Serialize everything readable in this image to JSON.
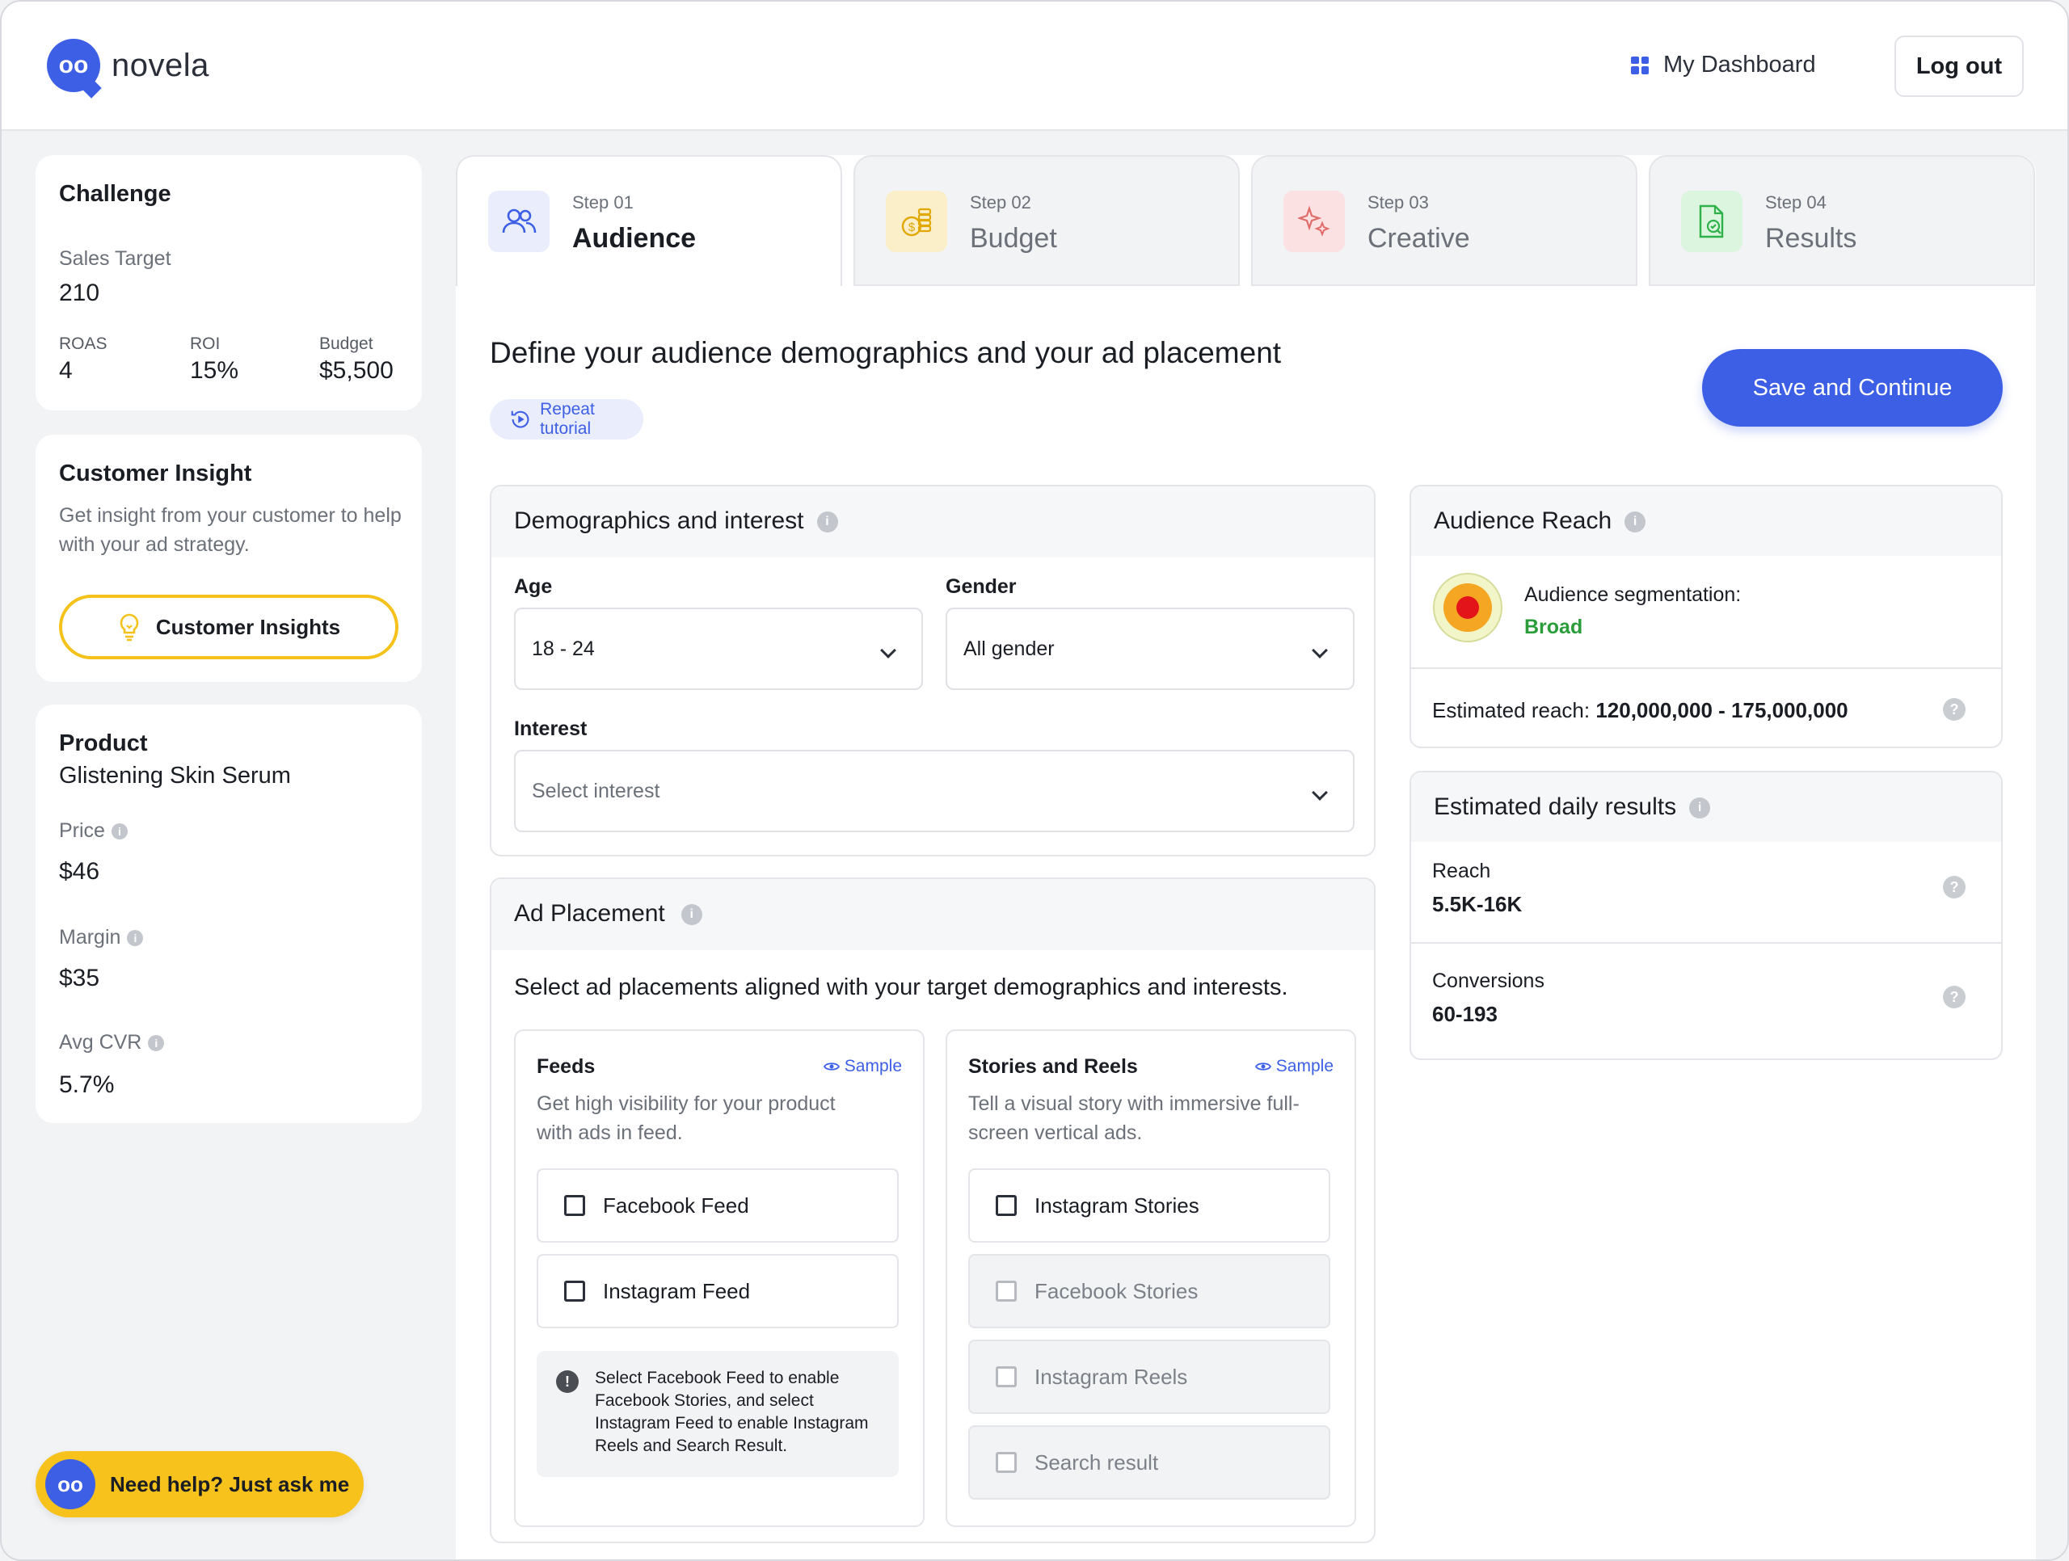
{
  "app": {
    "name": "novela",
    "logo_glyph": "oo"
  },
  "header": {
    "dashboard_label": "My Dashboard",
    "logout_label": "Log out"
  },
  "challenge": {
    "title": "Challenge",
    "sales_target_label": "Sales Target",
    "sales_target_value": "210",
    "roas_label": "ROAS",
    "roas_value": "4",
    "roi_label": "ROI",
    "roi_value": "15%",
    "budget_label": "Budget",
    "budget_value": "$5,500"
  },
  "insight": {
    "title": "Customer Insight",
    "description": "Get insight from your customer to help with your ad strategy.",
    "button_label": "Customer Insights"
  },
  "product": {
    "title": "Product",
    "name": "Glistening Skin Serum",
    "price_label": "Price",
    "price_value": "$46",
    "margin_label": "Margin",
    "margin_value": "$35",
    "cvr_label": "Avg CVR",
    "cvr_value": "5.7%"
  },
  "help": {
    "label": "Need help? Just ask me"
  },
  "steps": [
    {
      "step": "Step 01",
      "name": "Audience",
      "icon": "users-icon",
      "active": true
    },
    {
      "step": "Step 02",
      "name": "Budget",
      "icon": "coins-icon",
      "active": false
    },
    {
      "step": "Step 03",
      "name": "Creative",
      "icon": "sparkle-icon",
      "active": false
    },
    {
      "step": "Step 04",
      "name": "Results",
      "icon": "document-check-icon",
      "active": false
    }
  ],
  "main": {
    "heading": "Define your audience demographics and your ad placement",
    "tutorial_label": "Repeat tutorial",
    "save_label": "Save and Continue"
  },
  "demographics": {
    "title": "Demographics and interest",
    "age_label": "Age",
    "age_value": "18 - 24",
    "gender_label": "Gender",
    "gender_value": "All gender",
    "interest_label": "Interest",
    "interest_placeholder": "Select interest"
  },
  "placement": {
    "title": "Ad Placement",
    "description": "Select ad placements aligned with your target demographics and interests.",
    "feeds": {
      "title": "Feeds",
      "sample_label": "Sample",
      "description": "Get high visibility for your product with ads in feed.",
      "options": [
        {
          "label": "Facebook Feed",
          "checked": false,
          "disabled": false
        },
        {
          "label": "Instagram Feed",
          "checked": false,
          "disabled": false
        }
      ],
      "note": "Select Facebook Feed to enable Facebook Stories, and select Instagram Feed to enable Instagram Reels and Search Result."
    },
    "stories": {
      "title": "Stories and Reels",
      "sample_label": "Sample",
      "description": "Tell a visual story with immersive full-screen vertical ads.",
      "options": [
        {
          "label": "Instagram Stories",
          "checked": false,
          "disabled": false
        },
        {
          "label": "Facebook Stories",
          "checked": false,
          "disabled": true
        },
        {
          "label": "Instagram Reels",
          "checked": false,
          "disabled": true
        },
        {
          "label": "Search result",
          "checked": false,
          "disabled": true
        }
      ]
    }
  },
  "reach": {
    "title": "Audience Reach",
    "segmentation_label": "Audience segmentation:",
    "segmentation_value": "Broad",
    "estimated_label": "Estimated reach:",
    "estimated_value": "120,000,000 - 175,000,000"
  },
  "daily": {
    "title": "Estimated daily results",
    "reach_label": "Reach",
    "reach_value": "5.5K-16K",
    "conversions_label": "Conversions",
    "conversions_value": "60-193"
  },
  "colors": {
    "primary": "#3d5fe6",
    "accent_yellow": "#f7c21b",
    "success_green": "#2a9d3a"
  }
}
